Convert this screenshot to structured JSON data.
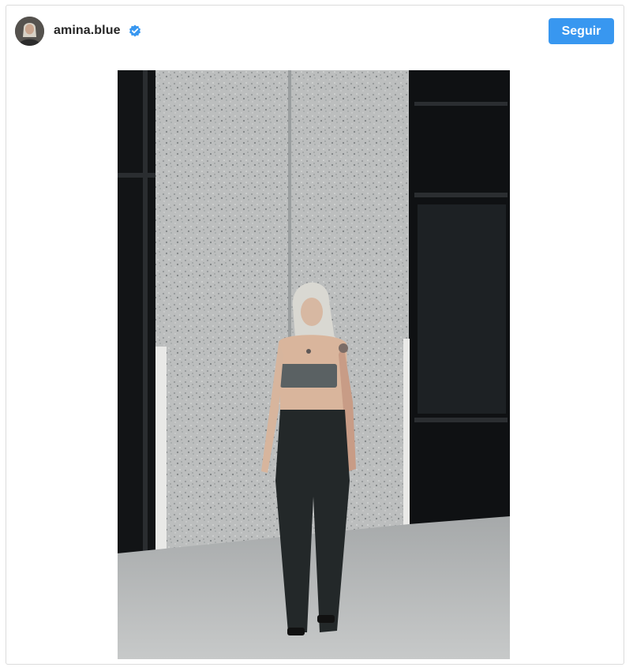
{
  "post": {
    "username": "amina.blue",
    "verified": true,
    "follow_label": "Seguir",
    "avatar_icon": "user-avatar",
    "verified_icon": "verified-badge-icon"
  },
  "colors": {
    "follow_button": "#3897f0",
    "verified_badge": "#3897f0",
    "username_text": "#262626",
    "card_border": "#dbdbdb"
  }
}
